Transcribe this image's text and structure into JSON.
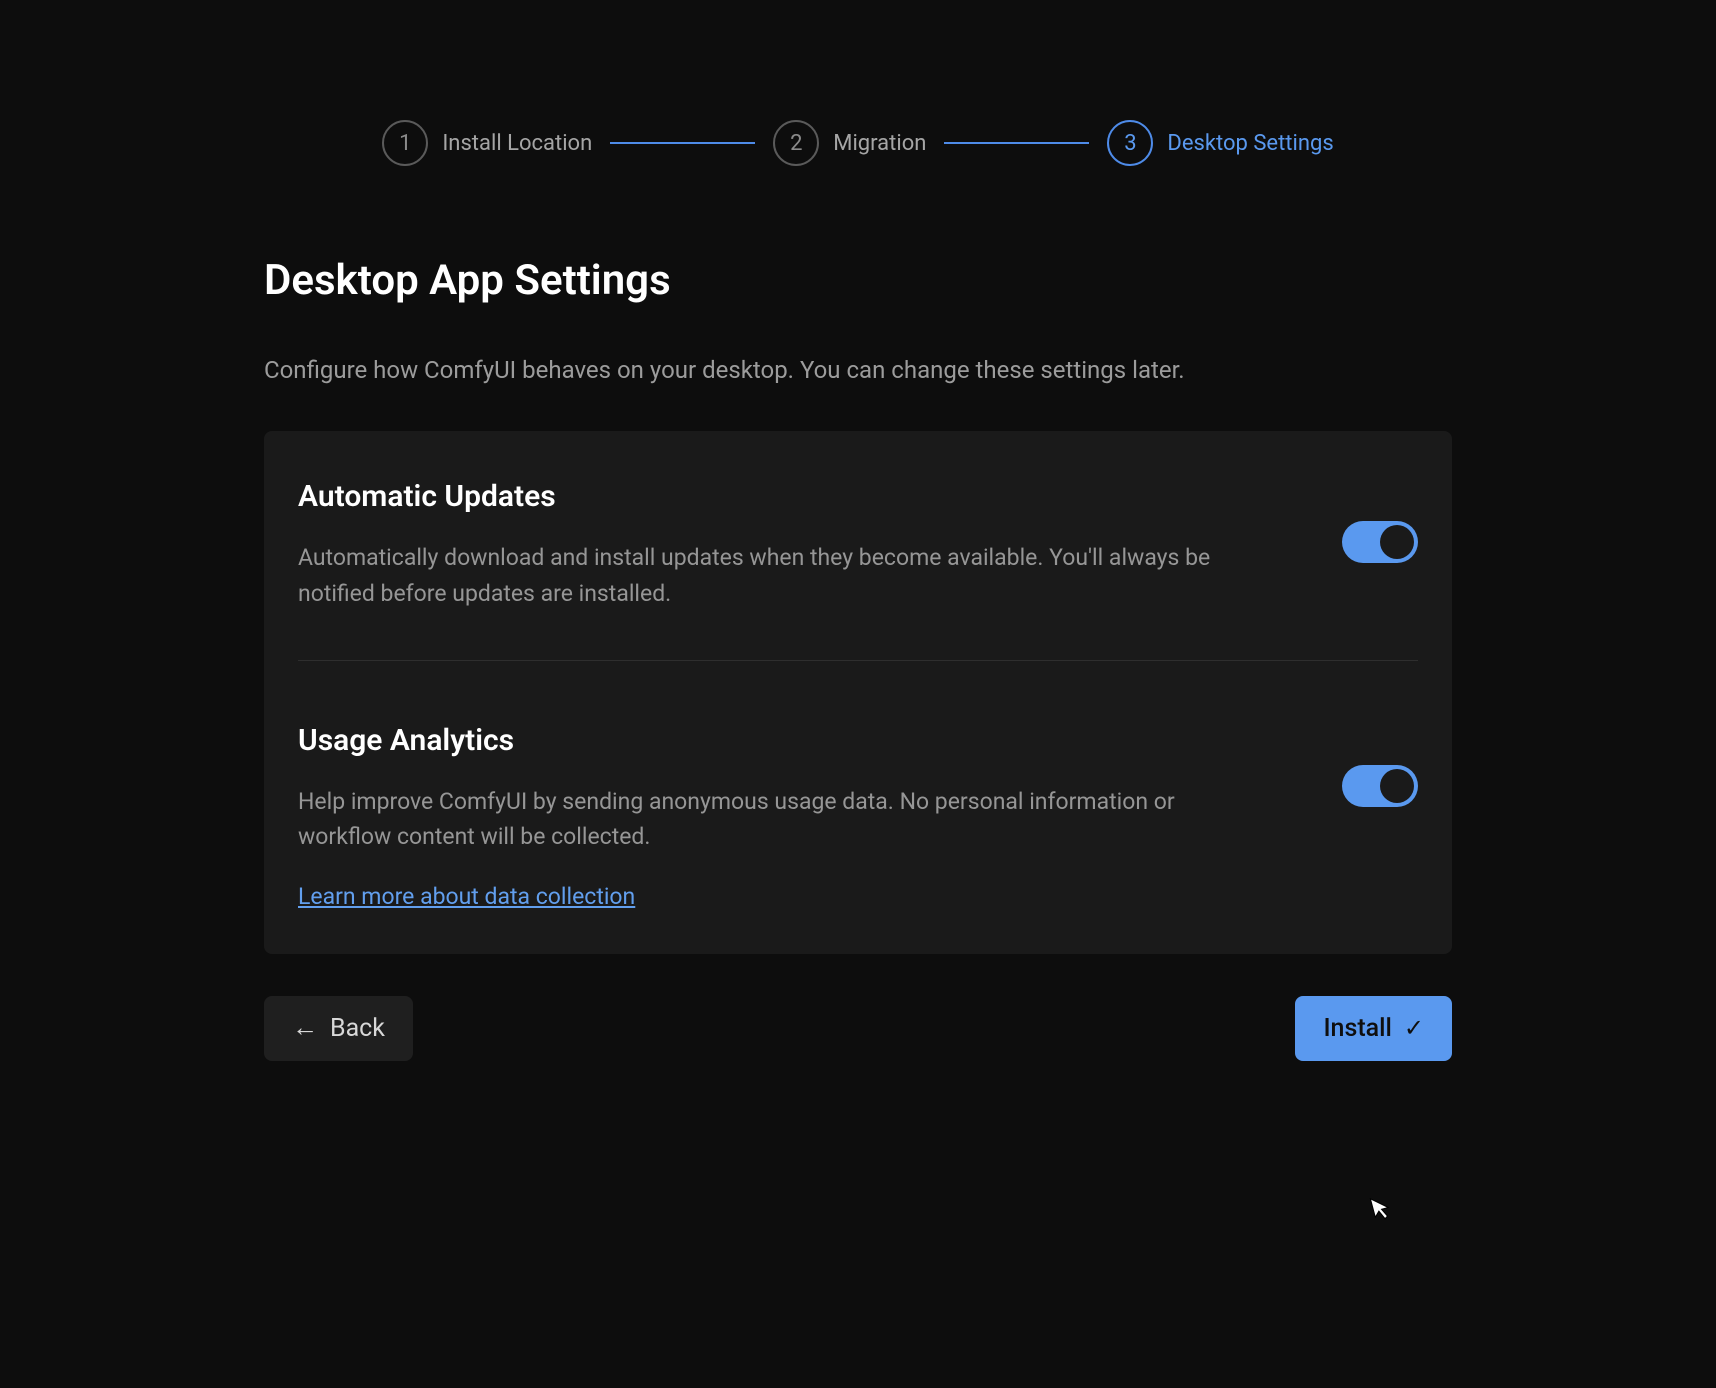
{
  "stepper": {
    "steps": [
      {
        "number": "1",
        "label": "Install Location",
        "active": false
      },
      {
        "number": "2",
        "label": "Migration",
        "active": false
      },
      {
        "number": "3",
        "label": "Desktop Settings",
        "active": true
      }
    ]
  },
  "page": {
    "title": "Desktop App Settings",
    "subtitle": "Configure how ComfyUI behaves on your desktop. You can change these settings later."
  },
  "settings": {
    "autoUpdate": {
      "title": "Automatic Updates",
      "description": "Automatically download and install updates when they become available. You'll always be notified before updates are installed.",
      "enabled": true
    },
    "analytics": {
      "title": "Usage Analytics",
      "description": "Help improve ComfyUI by sending anonymous usage data. No personal information or workflow content will be collected.",
      "link": "Learn more about data collection",
      "enabled": true
    }
  },
  "buttons": {
    "back": "Back",
    "install": "Install"
  }
}
